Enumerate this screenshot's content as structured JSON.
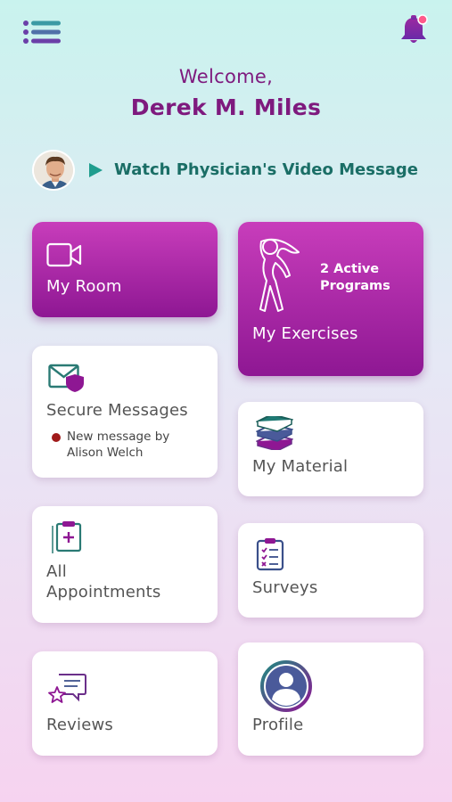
{
  "header": {
    "menu_icon": "hamburger-menu-icon",
    "notification_icon": "bell-icon",
    "notification_dot": true
  },
  "greeting": {
    "welcome": "Welcome,",
    "name": "Derek M. Miles"
  },
  "video": {
    "label": "Watch Physician's Video Message",
    "play_icon": "play-icon",
    "avatar": "physician-avatar"
  },
  "tiles": {
    "my_room": {
      "label": "My Room",
      "icon": "video-camera-icon"
    },
    "my_exercises": {
      "label": "My Exercises",
      "icon": "stretching-person-icon",
      "programs": "2 Active Programs"
    },
    "secure_messages": {
      "label": "Secure Messages",
      "icon": "secure-mail-icon",
      "notice": "New message by Alison Welch"
    },
    "my_material": {
      "label": "My Material",
      "icon": "books-icon"
    },
    "appointments": {
      "label_line1": "All",
      "label_line2": "Appointments",
      "icon": "clipboard-plus-icon"
    },
    "surveys": {
      "label": "Surveys",
      "icon": "checklist-icon"
    },
    "reviews": {
      "label": "Reviews",
      "icon": "review-chat-icon"
    },
    "profile": {
      "label": "Profile",
      "icon": "user-profile-icon"
    }
  },
  "colors": {
    "brand_purple": "#8e1793",
    "brand_purple_light": "#c83dbb",
    "teal": "#1a6e66",
    "notice_dot": "#a01a1a",
    "text_gray": "#555555"
  }
}
